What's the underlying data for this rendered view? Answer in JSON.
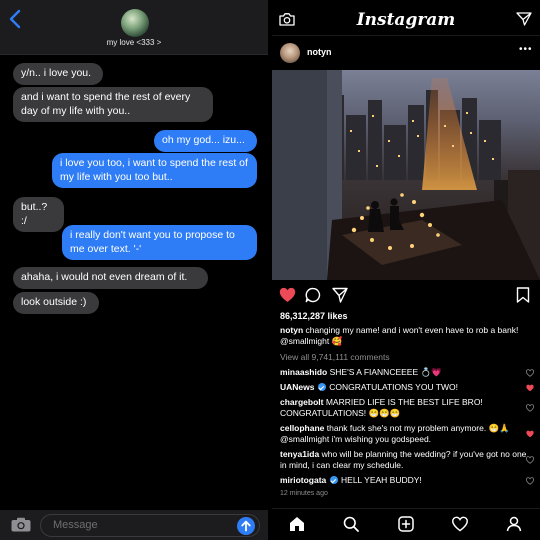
{
  "imessage": {
    "contact_name": "my love <333 >",
    "messages": [
      {
        "side": "in",
        "text": "y/n.. i love you."
      },
      {
        "side": "in",
        "text": "and i want to spend the rest of every day of my life with you.."
      },
      {
        "side": "out",
        "text": "oh my god... izu..."
      },
      {
        "side": "out",
        "text": "i love you too, i want to spend the rest of my life with you too but.."
      },
      {
        "side": "in",
        "text": "but..? :/"
      },
      {
        "side": "out",
        "text": "i really don't want you to propose to me over text. '-'"
      },
      {
        "side": "in",
        "text": "ahaha, i would not even dream of it."
      },
      {
        "side": "in",
        "text": "look outside :)"
      }
    ],
    "compose_placeholder": "Message",
    "colors": {
      "incoming": "#3a3a3c",
      "outgoing": "#2f7df6"
    }
  },
  "instagram": {
    "wordmark": "Instagram",
    "post": {
      "username": "notyn",
      "more": "•••",
      "likes": "86,312,287 likes",
      "caption_user": "notyn",
      "caption_text": " changing my name! and i won't even have to rob a bank! @smallmight 🥰",
      "view_all": "View all 9,741,111 comments",
      "timestamp": "12 minutes ago"
    },
    "comments": [
      {
        "user": "minaashido",
        "verified": false,
        "text": " SHE'S A FIANNCEEEE 💍💗",
        "liked": false
      },
      {
        "user": "UANews",
        "verified": true,
        "text": " CONGRATULATIONS YOU TWO!",
        "liked": true
      },
      {
        "user": "chargebolt",
        "verified": false,
        "text": " MARRIED LIFE IS THE BEST LIFE BRO! CONGRATULATIONS! 😁😁😁",
        "liked": false
      },
      {
        "user": "cellophane",
        "verified": false,
        "text": " thank fuck she's not my problem anymore. 😁🙏 @smallmight i'm wishing you godspeed.",
        "liked": true
      },
      {
        "user": "tenya1ida",
        "verified": false,
        "text": " who will be planning the wedding? if you've got no one in mind, i can clear my schedule.",
        "liked": false
      },
      {
        "user": "miriotogata",
        "verified": true,
        "text": " HELL YEAH BUDDY!",
        "liked": false
      }
    ],
    "icons": {
      "top": [
        "camera-icon",
        "direct-message-icon"
      ],
      "actions": [
        "heart-icon",
        "comment-icon",
        "share-icon",
        "bookmark-icon"
      ],
      "nav": [
        "home-icon",
        "search-icon",
        "add-post-icon",
        "activity-heart-icon",
        "profile-icon"
      ]
    },
    "colors": {
      "like_red": "#ed4956",
      "verified_blue": "#3897f0"
    }
  }
}
